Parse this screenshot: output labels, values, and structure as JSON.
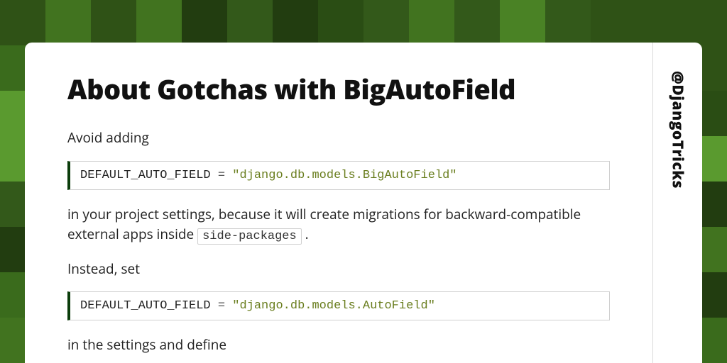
{
  "bg_palette": [
    "#2a4d14",
    "#3a6b1c",
    "#4a8225",
    "#5a9a2f",
    "#223d10",
    "#33591a",
    "#41731f",
    "#2f5216"
  ],
  "title": "About Gotchas with BigAutoField",
  "handle": "@DjangoTricks",
  "p1": "Avoid adding",
  "code1": {
    "lhs": "DEFAULT_AUTO_FIELD",
    "eq": " = ",
    "rhs": "\"django.db.models.BigAutoField\""
  },
  "p2a": "in your project settings, because it will create migrations for backward-compatible external apps inside ",
  "p2_code": "side-packages",
  "p2b": " .",
  "p3": "Instead, set",
  "code2": {
    "lhs": "DEFAULT_AUTO_FIELD",
    "eq": " = ",
    "rhs": "\"django.db.models.AutoField\""
  },
  "p4": "in the settings and define"
}
